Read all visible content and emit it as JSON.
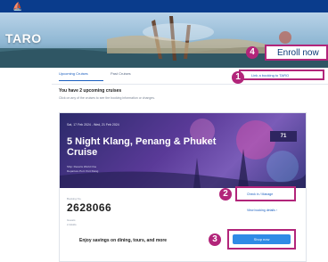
{
  "app": {
    "brand": "TARO",
    "top_logo": "⛵"
  },
  "callouts": {
    "enroll": {
      "number": "4",
      "label": "Enroll now"
    },
    "link": {
      "number": "1",
      "label": "Link a booking to TARO"
    },
    "manage": {
      "number": "2",
      "label": "Check in / Manage"
    },
    "cta": {
      "number": "3",
      "label": "Shop now"
    }
  },
  "main": {
    "tabs": [
      {
        "label": "Upcoming Cruises",
        "active": true
      },
      {
        "label": "Past Cruises",
        "active": false
      }
    ],
    "heading": "You have 2 upcoming cruises",
    "subheading": "Click on any of the cruises to see the booking information or changes."
  },
  "cruise_card": {
    "dates": "Sat, 17 Feb 2024 - Wed, 21 Feb 2024",
    "title": "5 Night Klang, Penang & Phuket Cruise",
    "meta_line1": "Ship: Resorts World One",
    "meta_line2": "Departure Port: Port Klang",
    "badge": "71",
    "pax_label": "Booking No.",
    "booking_number": "2628066",
    "meta2_line1": "Guests",
    "meta2_line2": "2 Adults",
    "details_link": "View booking details ›"
  },
  "promo": {
    "text": "Enjoy savings on dining, tours, and more"
  },
  "colors": {
    "callout": "#b2257a",
    "primary": "#1a5ebf",
    "topbar": "#0a3c8c",
    "cta": "#2f8be6"
  }
}
